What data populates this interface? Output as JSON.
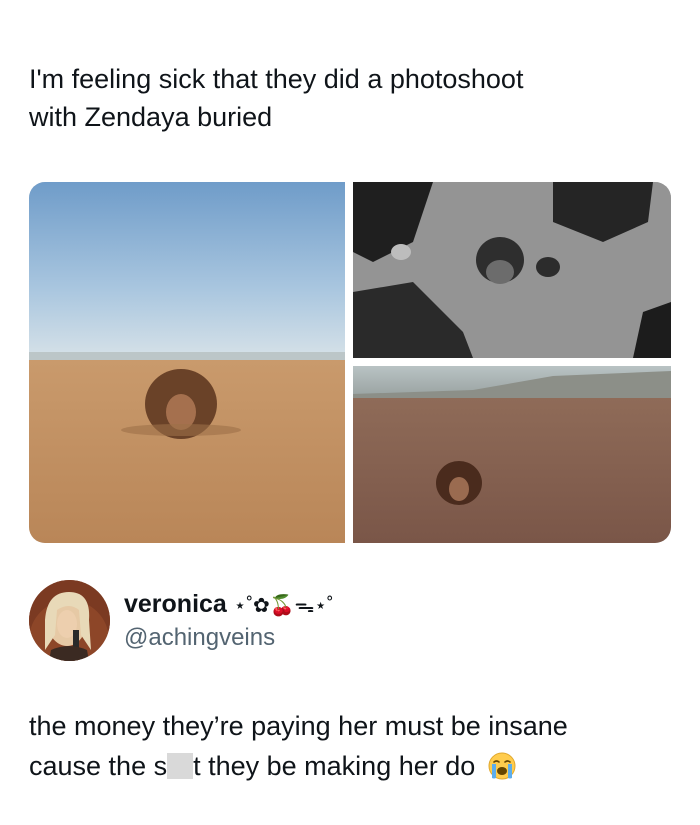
{
  "post": {
    "caption_line1": "I'm feeling sick that they did a photoshoot",
    "caption_line2": "with Zendaya buried"
  },
  "photos": [
    {
      "name": "desert-wide-shot"
    },
    {
      "name": "bw-overhead-shot"
    },
    {
      "name": "desert-far-shot"
    }
  ],
  "reply": {
    "display_name": "veronica",
    "display_name_decoration": "⋆˚✿🍒ᯓ⋆˚",
    "handle": "@achingveins",
    "text_line1": "the money they’re paying her must be insane",
    "text_line2_start": "cause the s",
    "text_line2_end": "t they be making her do",
    "emoji": "loudly-crying-face"
  },
  "colors": {
    "text": "#0f1419",
    "secondary_text": "#536471",
    "censor_box": "#d9d9d9"
  }
}
